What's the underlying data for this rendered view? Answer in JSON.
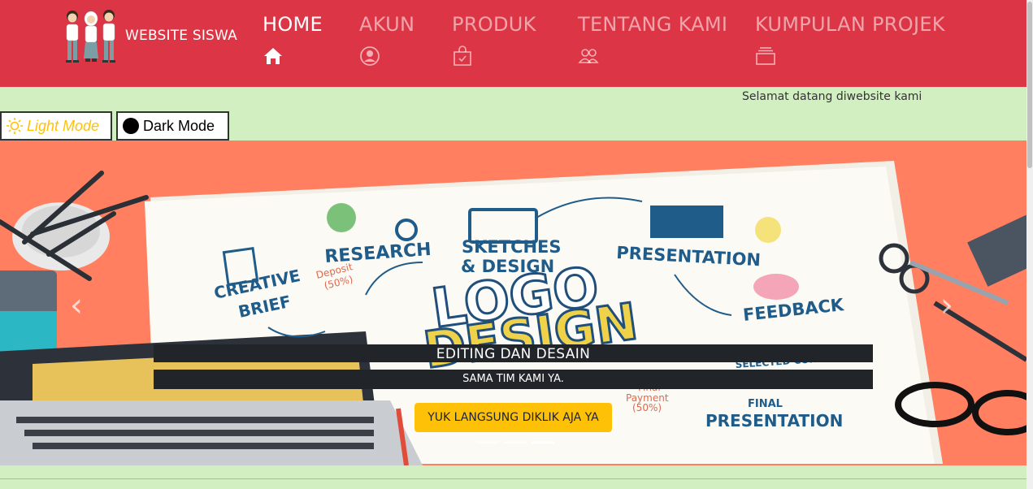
{
  "brand": {
    "name": "WEBSITE SISWA",
    "logo_icon": "students-logo"
  },
  "nav": [
    {
      "label": "HOME",
      "icon": "home-icon",
      "active": true
    },
    {
      "label": "AKUN",
      "icon": "user-circle-icon",
      "active": false
    },
    {
      "label": "PRODUK",
      "icon": "bag-check-icon",
      "active": false
    },
    {
      "label": "TENTANG KAMI",
      "icon": "people-icon",
      "active": false
    },
    {
      "label": "KUMPULAN PROJEK",
      "icon": "collection-icon",
      "active": false
    }
  ],
  "welcome": "Selamat datang diwebsite kami",
  "modes": {
    "light": "Light Mode",
    "dark": "Dark Mode"
  },
  "carousel": {
    "title": "EDITING DAN DESAIN",
    "subtitle": "SAMA TIM KAMI YA.",
    "cta": "YUK LANGSUNG DIKLIK AJA YA",
    "prev": "‹",
    "next": "›",
    "slide_count": 3,
    "active_slide": 3,
    "art_text": {
      "research": "RESEARCH",
      "deposit": "Deposit",
      "deposit_pct": "(50%)",
      "sketches": "SKETCHES",
      "design": "& DESIGN",
      "presentation": "PRESENTATION",
      "creative": "CREATIVE",
      "brief": "BRIEF",
      "logo": "LOGO",
      "design_big": "DESIGN",
      "feedback": "FEEDBACK",
      "selected": "SELECTED CONCEPT",
      "final": "Final",
      "payment": "Payment",
      "payment_pct": "(50%)",
      "final2": "FINAL",
      "presentation2": "PRESENTATION"
    }
  },
  "colors": {
    "header": "#dc3545",
    "page_bg": "#d2efc1",
    "banner_bg": "#ff7f60",
    "cta": "#ffc107"
  }
}
